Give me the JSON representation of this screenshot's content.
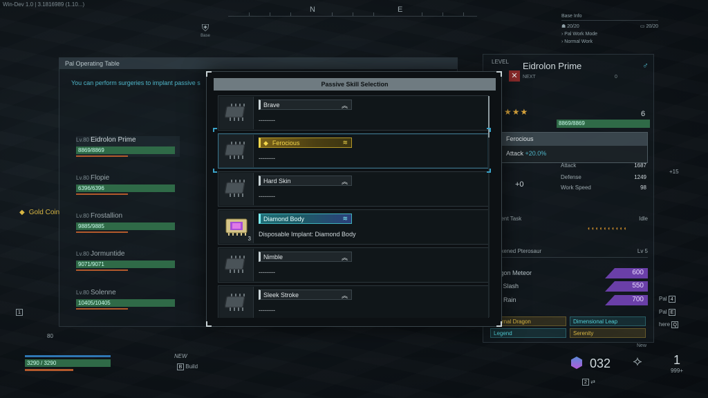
{
  "hud": {
    "version": "Win-Dev 1.0 | 3.1816989 (1.10...)",
    "compass_n": "N",
    "compass_e": "E",
    "base_marker_label": "Base",
    "base_info_title": "Base Info",
    "base_count_1": "20/20",
    "base_count_2": "20/20",
    "work_mode_label": "Pal Work Mode",
    "work_mode_value": "Normal Work",
    "gold_label": "Gold Coin",
    "player_hp": "3290 / 3290",
    "new_label": "NEW",
    "build_label": "Build",
    "build_key": "B",
    "key_1": "1",
    "level_80": "80",
    "ammo_count": "032",
    "ammo_key": "2",
    "ammo2_count": "1",
    "ammo2_reserve": "999+",
    "pal_key_label": "Pal",
    "pal_key_4": "4",
    "pal_key_e_label": "Pal",
    "pal_key_e": "E",
    "here_label": "here",
    "here_key": "Q",
    "plus15": "+15"
  },
  "left_panel": {
    "title": "Pal Operating Table",
    "description": "You can perform surgeries to implant passive s",
    "pals": [
      {
        "level": "Lv.80",
        "name": "Eidrolon Prime",
        "hp": "8869/8869"
      },
      {
        "level": "Lv.80",
        "name": "Flopie",
        "hp": "6396/6396"
      },
      {
        "level": "Lv.80",
        "name": "Frostallion",
        "hp": "9885/9885"
      },
      {
        "level": "Lv.80",
        "name": "Jormuntide",
        "hp": "9071/9071"
      },
      {
        "level": "Lv.80",
        "name": "Solenne",
        "hp": "10405/10405"
      }
    ]
  },
  "right_panel": {
    "level_label": "LEVEL",
    "name": "Eidrolon Prime",
    "gender_icon": "male-icon",
    "next_label": "NEXT",
    "next_value": "0",
    "stars": "★★★",
    "rank": "6",
    "hp": "8869/8869",
    "plus0": "+0",
    "stats": [
      {
        "label": "Attack",
        "value": "1687"
      },
      {
        "label": "Defense",
        "value": "1249"
      },
      {
        "label": "Work Speed",
        "value": "98"
      }
    ],
    "task_label": "Current Task",
    "task_value": "Idle",
    "partner_label": "Awakened Pterosaur",
    "partner_level": "Lv 5",
    "skills": [
      {
        "label": "Dragon Meteor",
        "value": "600"
      },
      {
        "label": "Ray Slash",
        "value": "550"
      },
      {
        "label": "Star Rain",
        "value": "700"
      }
    ],
    "passives": [
      {
        "label": "Eternal Dragon",
        "style": "gold"
      },
      {
        "label": "Dimensional Leap",
        "style": "teal"
      },
      {
        "label": "Legend",
        "style": "teal"
      },
      {
        "label": "Serenity",
        "style": "gold"
      }
    ],
    "new_label": "New"
  },
  "tooltip": {
    "title": "Ferocious",
    "stat_label": "Attack",
    "stat_value": "+20.0%"
  },
  "modal": {
    "title": "Passive Skill Selection",
    "items": [
      {
        "name": "Brave",
        "desc": "--------",
        "style": "plain",
        "rank_icon": "rank-up-icon",
        "rank_glyph": "︽",
        "count": ""
      },
      {
        "name": "Ferocious",
        "desc": "--------",
        "style": "gold",
        "rank_icon": "rank-triple-icon",
        "rank_glyph": "≋",
        "count": ""
      },
      {
        "name": "Hard Skin",
        "desc": "--------",
        "style": "plain",
        "rank_icon": "rank-up-icon",
        "rank_glyph": "︽",
        "count": ""
      },
      {
        "name": "Diamond Body",
        "desc": "Disposable Implant: Diamond Body",
        "style": "teal",
        "rank_icon": "rank-legendary-icon",
        "rank_glyph": "≋",
        "count": "3"
      },
      {
        "name": "Nimble",
        "desc": "--------",
        "style": "plain",
        "rank_icon": "rank-up-icon",
        "rank_glyph": "︽",
        "count": ""
      },
      {
        "name": "Sleek Stroke",
        "desc": "--------",
        "style": "plain",
        "rank_icon": "rank-up-icon",
        "rank_glyph": "︽",
        "count": ""
      }
    ]
  }
}
